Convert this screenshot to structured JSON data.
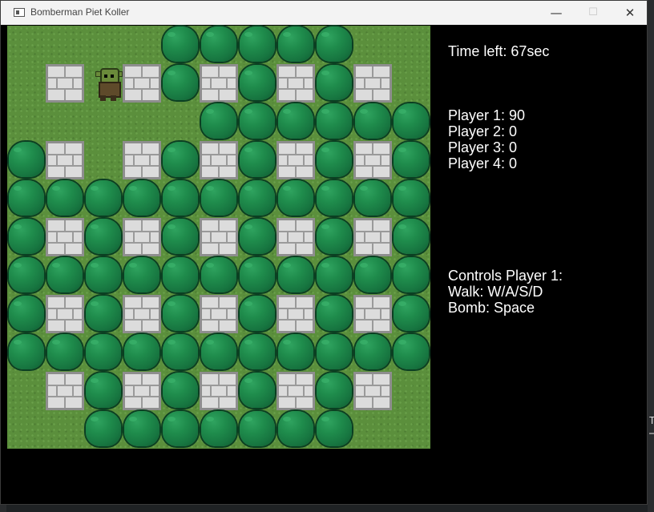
{
  "window": {
    "title": "Bomberman Piet Koller",
    "minimize_glyph": "—",
    "maximize_glyph": "☐",
    "close_glyph": "✕"
  },
  "hud": {
    "time_left": "Time left: 67sec",
    "scores": [
      "Player 1: 90",
      "Player 2: 0",
      "Player 3: 0",
      "Player 4: 0"
    ],
    "controls_title": "Controls Player 1:",
    "controls": [
      "Walk: W/A/S/D",
      "Bomb: Space"
    ]
  },
  "board": {
    "rows": 11,
    "cols": 11,
    "legend": {
      "G": "grass",
      "W": "stone-wall",
      "B": "bush"
    },
    "map": [
      "GGGGBBBBBGG",
      "GWGWBWBWBWG",
      "GGGGGBBBBBB",
      "BWGWBWBWBWB",
      "BBBBBBBBBBB",
      "BWBWBWBWBWB",
      "BBBBBBBBBBB",
      "BWBWBWBWBWB",
      "BBBBBBBBBBB",
      "GWBWBWBWBWG",
      "GGBBBBBBBGG"
    ],
    "player_icon": "orc-player-1"
  }
}
